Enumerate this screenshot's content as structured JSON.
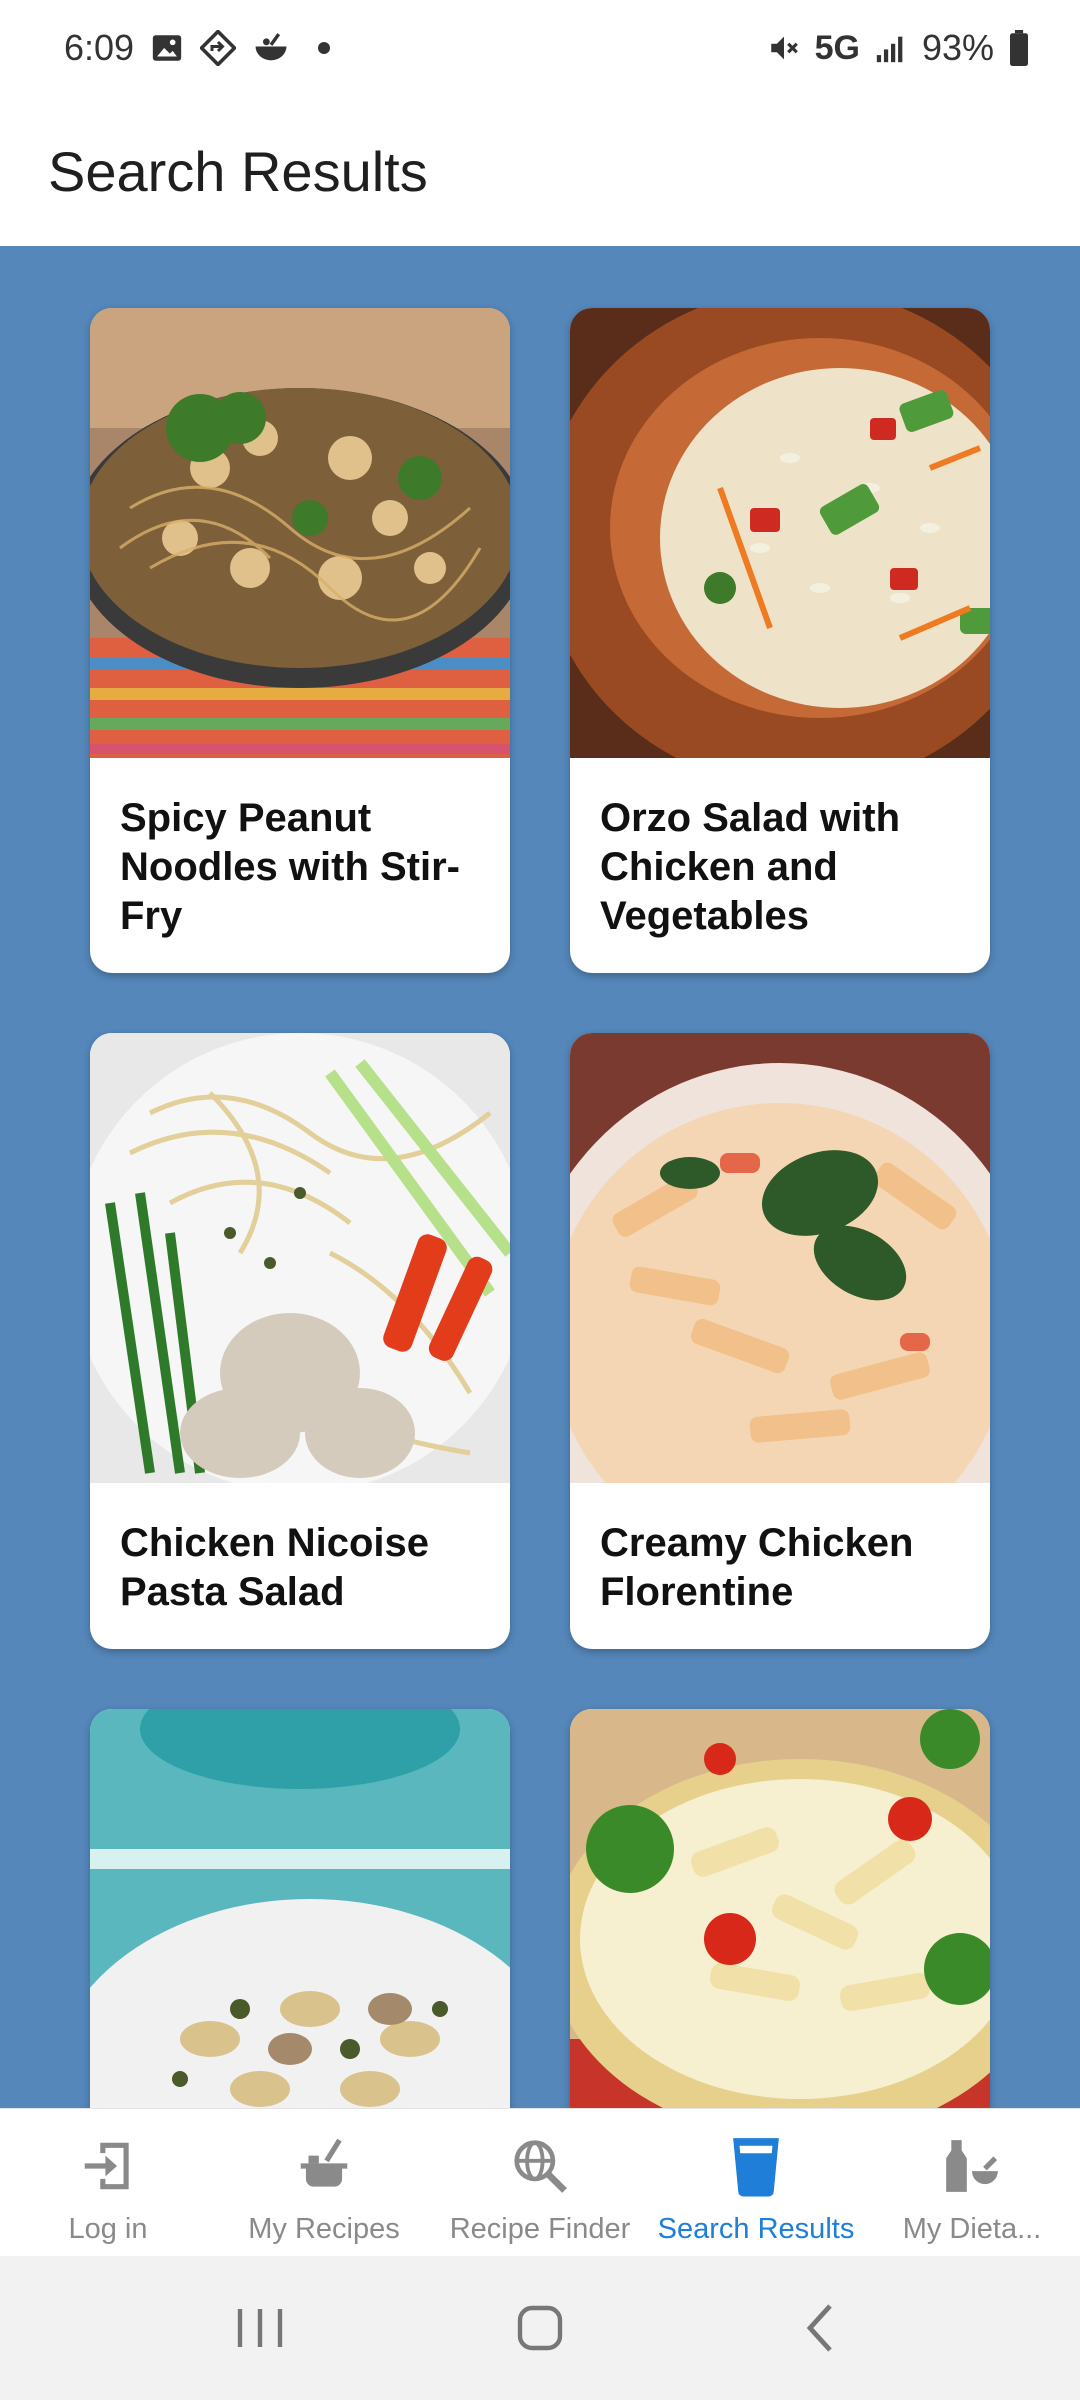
{
  "status_bar": {
    "time": "6:09",
    "network": "5G",
    "battery": "93%",
    "left_icons": [
      "gallery-icon",
      "navigation-icon",
      "app-icon"
    ],
    "right_icons": [
      "mute-icon",
      "signal-icon",
      "battery-icon"
    ]
  },
  "header": {
    "title": "Search Results"
  },
  "recipes": [
    {
      "title": "Spicy Peanut Noodles with Stir-Fry"
    },
    {
      "title": "Orzo Salad with Chicken and Vegetables"
    },
    {
      "title": "Chicken Nicoise Pasta Salad"
    },
    {
      "title": "Creamy Chicken Florentine"
    },
    {
      "title": ""
    },
    {
      "title": ""
    }
  ],
  "bottom_nav": {
    "items": [
      {
        "label": "Log in",
        "icon": "login-icon",
        "active": false
      },
      {
        "label": "My Recipes",
        "icon": "pot-icon",
        "active": false
      },
      {
        "label": "Recipe Finder",
        "icon": "globe-search-icon",
        "active": false
      },
      {
        "label": "Search Results",
        "icon": "cup-icon",
        "active": true
      },
      {
        "label": "My Dieta...",
        "icon": "mortar-bottle-icon",
        "active": false
      }
    ]
  },
  "colors": {
    "content_bg": "#5587bb",
    "active_tab": "#1e7ed8",
    "inactive_tab": "#8a8a8a"
  }
}
